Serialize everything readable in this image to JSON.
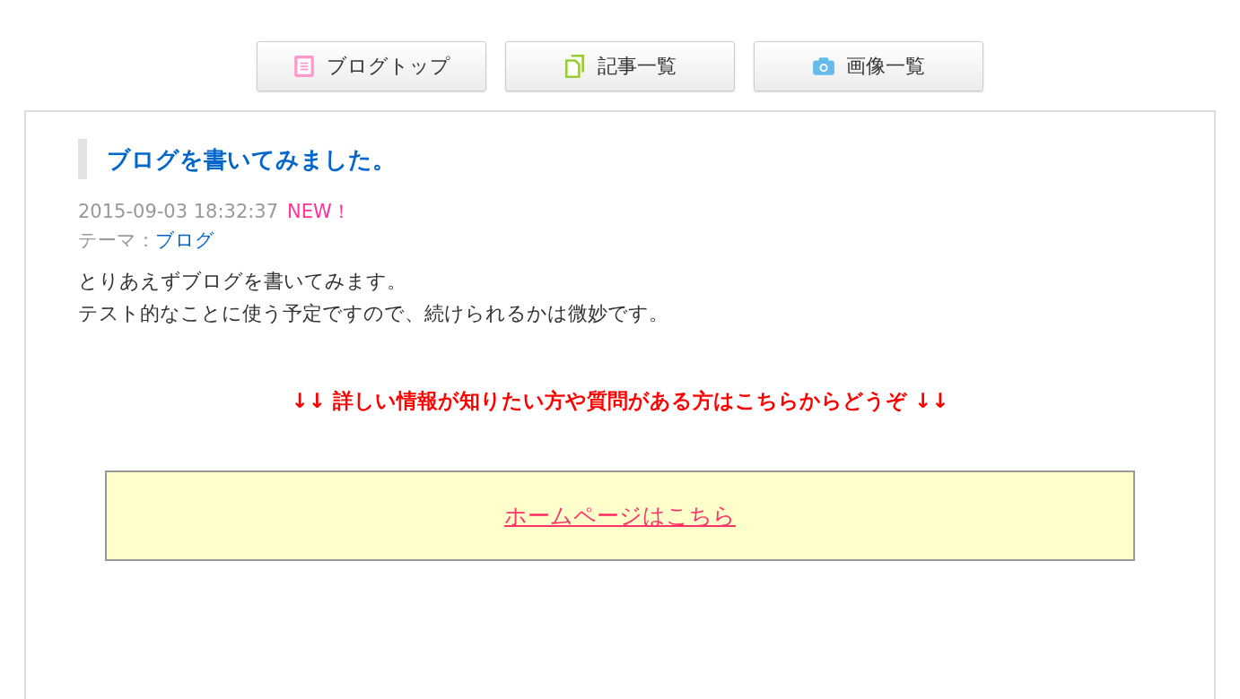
{
  "nav": [
    {
      "label": "ブログトップ",
      "kind": "document"
    },
    {
      "label": "記事一覧",
      "kind": "copy"
    },
    {
      "label": "画像一覧",
      "kind": "camera"
    }
  ],
  "article": {
    "title": "ブログを書いてみました。",
    "date": "2015-09-03 18:32:37",
    "badge": "NEW！",
    "theme_label": "テーマ：",
    "theme": "ブログ",
    "body": [
      "とりあえずブログを書いてみます。",
      "テスト的なことに使う予定ですので、続けられるかは微妙です。"
    ],
    "notice": "↓↓ 詳しい情報が知りたい方や質問がある方はこちらからどうぞ ↓↓",
    "link": "ホームページはこちら"
  }
}
